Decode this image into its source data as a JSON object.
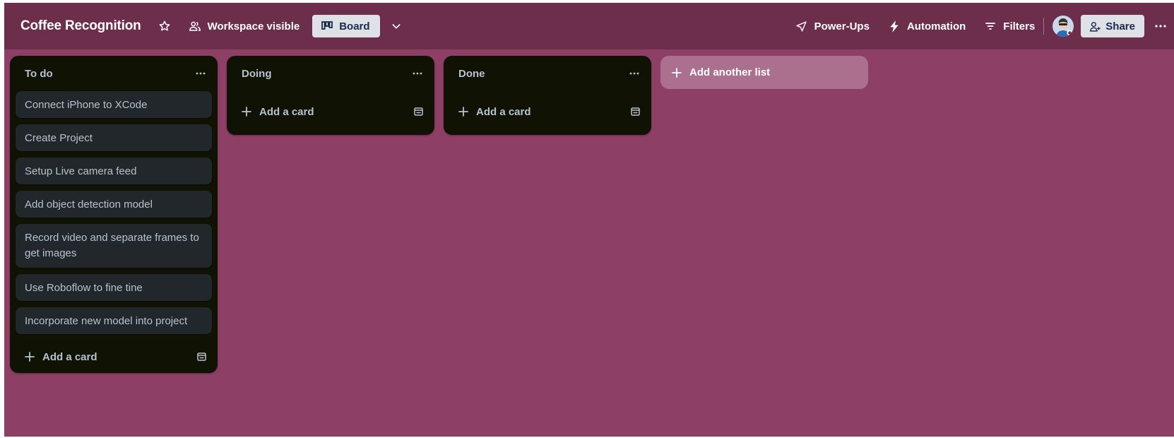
{
  "board": {
    "title": "Coffee Recognition",
    "visibility_label": "Workspace visible",
    "view_label": "Board"
  },
  "header_actions": {
    "powerups_label": "Power-Ups",
    "automation_label": "Automation",
    "filters_label": "Filters",
    "share_label": "Share"
  },
  "lists": [
    {
      "title": "To do",
      "cards": [
        "Connect iPhone to XCode",
        "Create Project",
        "Setup Live camera feed",
        "Add object detection model",
        "Record video and separate frames to get images",
        "Use Roboflow to fine tine",
        "Incorporate new model into project"
      ],
      "add_label": "Add a card"
    },
    {
      "title": "Doing",
      "cards": [],
      "add_label": "Add a card"
    },
    {
      "title": "Done",
      "cards": [],
      "add_label": "Add a card"
    }
  ],
  "add_list_label": "Add another list",
  "colors": {
    "board_background": "#8e3f66",
    "header_background": "#6d2e4c",
    "list_background": "#101204",
    "card_background": "#22272b",
    "card_text": "#b6c2cf"
  }
}
